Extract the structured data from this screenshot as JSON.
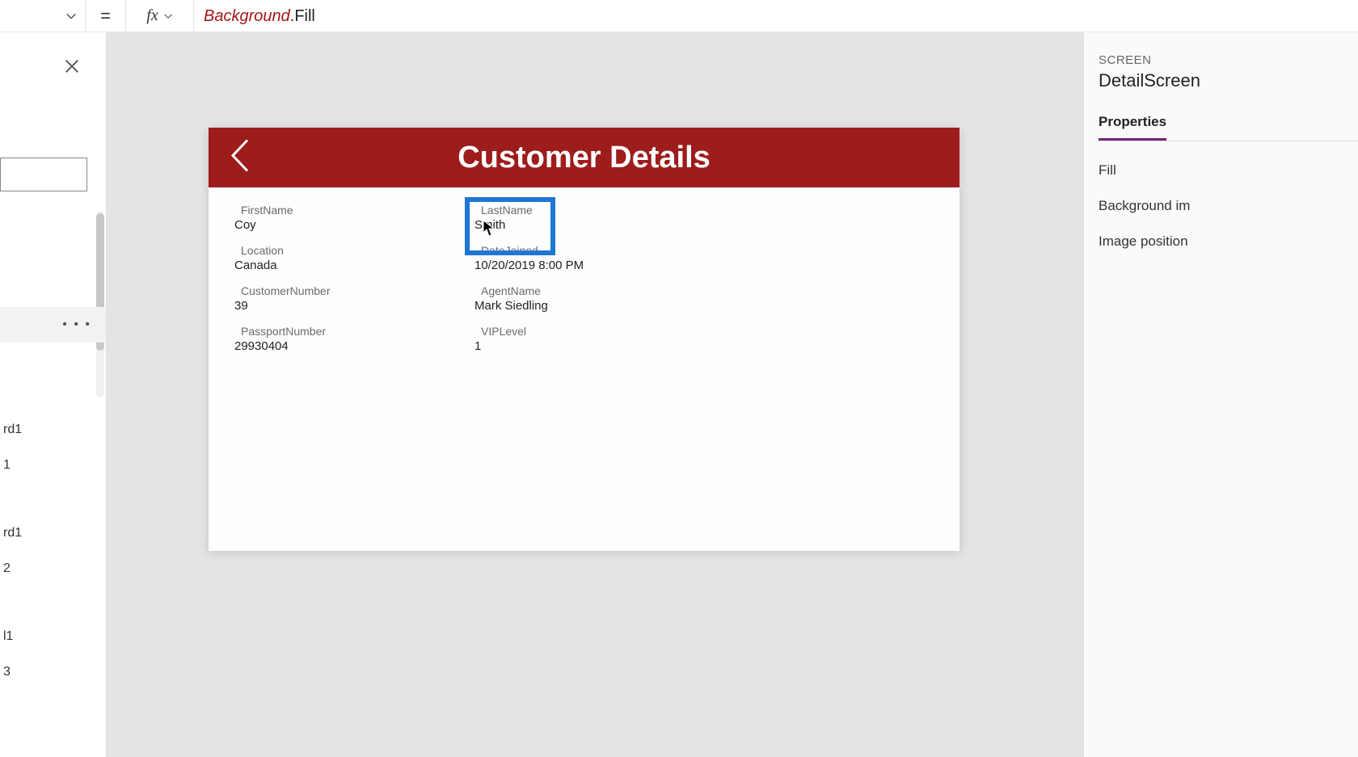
{
  "formula_bar": {
    "equals": "=",
    "fx": "fx",
    "token_ref": "Background",
    "token_dot": ".",
    "token_prop": "Fill"
  },
  "left_tree": {
    "selected_more": "• • •",
    "nodes": [
      {
        "label": "rd1"
      },
      {
        "label": "1"
      },
      {
        "label": "rd1"
      },
      {
        "label": "2"
      },
      {
        "label": "l1"
      },
      {
        "label": "3"
      }
    ]
  },
  "canvas": {
    "header_title": "Customer Details",
    "fields": [
      {
        "label": "FirstName",
        "value": "Coy",
        "selected": false
      },
      {
        "label": "LastName",
        "value": "Smith",
        "selected": true
      },
      {
        "label": "Location",
        "value": "Canada",
        "selected": false
      },
      {
        "label": "DateJoined",
        "value": "10/20/2019 8:00 PM",
        "selected": false
      },
      {
        "label": "CustomerNumber",
        "value": "39",
        "selected": false
      },
      {
        "label": "AgentName",
        "value": "Mark Siedling",
        "selected": false
      },
      {
        "label": "PassportNumber",
        "value": "29930404",
        "selected": false
      },
      {
        "label": "VIPLevel",
        "value": "1",
        "selected": false
      }
    ]
  },
  "right_panel": {
    "kind": "SCREEN",
    "name": "DetailScreen",
    "tabs": {
      "properties": "Properties"
    },
    "props": [
      {
        "label": "Fill"
      },
      {
        "label": "Background im"
      },
      {
        "label": "Image position"
      }
    ]
  }
}
